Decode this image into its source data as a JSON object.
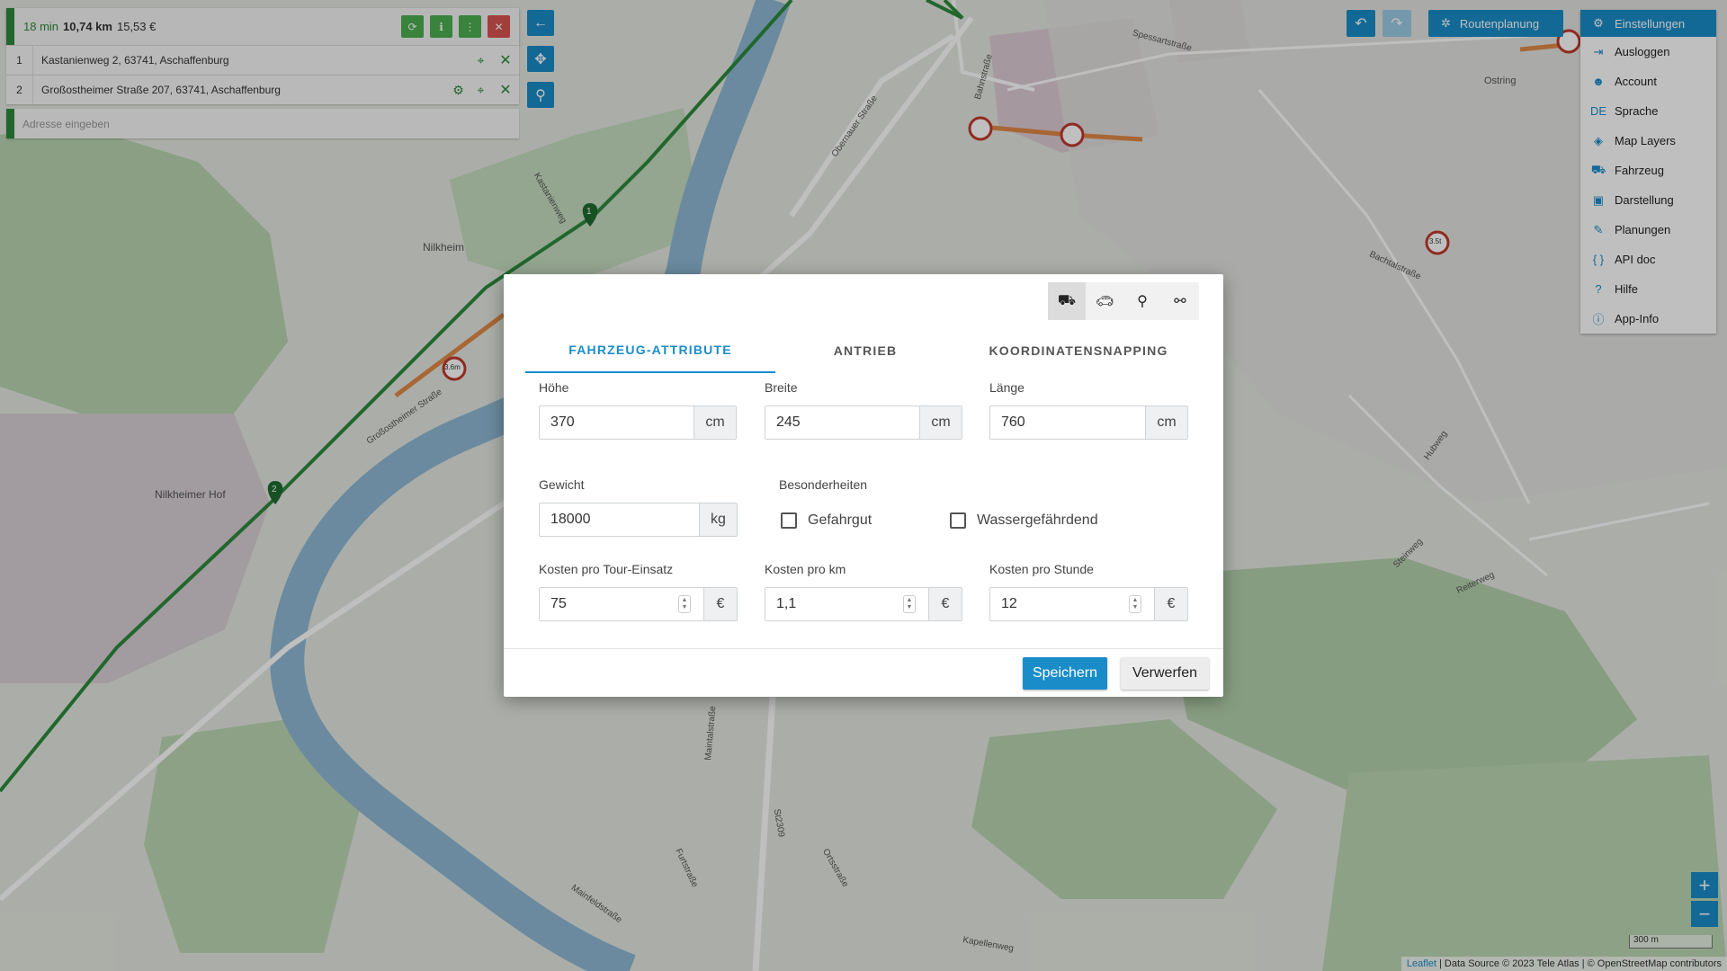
{
  "route_summary": {
    "time": "18 min",
    "distance": "10,74 km",
    "cost": "15,53 €"
  },
  "waypoints": [
    {
      "num": "1",
      "address": "Kastanienweg 2, 63741, Aschaffenburg"
    },
    {
      "num": "2",
      "address": "Großostheimer Straße 207, 63741, Aschaffenburg"
    }
  ],
  "address_input": {
    "placeholder": "Adresse eingeben"
  },
  "top_buttons": {
    "route_planning": "Routenplanung",
    "settings": "Einstellungen"
  },
  "settings_menu": [
    {
      "label": "Ausloggen",
      "icon": "logout-icon"
    },
    {
      "label": "Account",
      "icon": "account-icon"
    },
    {
      "label": "Sprache",
      "icon": "language-icon",
      "icon_text": "DE"
    },
    {
      "label": "Map Layers",
      "icon": "layers-icon"
    },
    {
      "label": "Fahrzeug",
      "icon": "truck-icon"
    },
    {
      "label": "Darstellung",
      "icon": "map-display-icon"
    },
    {
      "label": "Planungen",
      "icon": "planning-icon"
    },
    {
      "label": "API doc",
      "icon": "api-braces-icon",
      "icon_text": "{ }"
    },
    {
      "label": "Hilfe",
      "icon": "help-icon"
    },
    {
      "label": "App-Info",
      "icon": "info-icon"
    }
  ],
  "modal": {
    "tabs": [
      "FAHRZEUG-ATTRIBUTE",
      "ANTRIEB",
      "KOORDINATENSNAPPING"
    ],
    "active_tab": 0,
    "vehicle_types": [
      "truck-icon",
      "car-icon",
      "bicycle-icon",
      "racing-bicycle-icon"
    ],
    "fields": {
      "hoehe": {
        "label": "Höhe",
        "value": "370",
        "unit": "cm"
      },
      "breite": {
        "label": "Breite",
        "value": "245",
        "unit": "cm"
      },
      "laenge": {
        "label": "Länge",
        "value": "760",
        "unit": "cm"
      },
      "gewicht": {
        "label": "Gewicht",
        "value": "18000",
        "unit": "kg"
      },
      "besonderheiten": {
        "label": "Besonderheiten",
        "gefahrgut": "Gefahrgut",
        "wasser": "Wassergefährdend"
      },
      "kosten_einsatz": {
        "label": "Kosten pro Tour-Einsatz",
        "value": "75",
        "unit": "€"
      },
      "kosten_km": {
        "label": "Kosten pro km",
        "value": "1,1",
        "unit": "€"
      },
      "kosten_stunde": {
        "label": "Kosten pro Stunde",
        "value": "12",
        "unit": "€"
      }
    },
    "save": "Speichern",
    "discard": "Verwerfen"
  },
  "map": {
    "place_labels": [
      "Nilkheim",
      "Nilkheimer Hof",
      "Ostring"
    ],
    "street_labels": [
      "Kastanienweg",
      "Großostheimer Straße",
      "Obernauer Straße",
      "Bahnstraße",
      "Maintalstraße",
      "Mainfeldstraße",
      "Furtstraße",
      "Ortsstraße",
      "Kapellenweg",
      "St2309",
      "Reiterweg",
      "Steinweg",
      "Hubweg",
      "Bachtalstraße",
      "Spessartstraße"
    ],
    "markers": [
      "1",
      "2"
    ],
    "restriction_labels": [
      "3.6m",
      "3.5t"
    ]
  },
  "scale": "300 m",
  "attribution": {
    "leaflet": "Leaflet",
    "rest": " | Data Source © 2023 Tele Atlas | © OpenStreetMap contributors"
  },
  "colors": {
    "accent": "#1a8dc9",
    "route": "#2d8a3c",
    "restriction": "#e07a2d"
  }
}
